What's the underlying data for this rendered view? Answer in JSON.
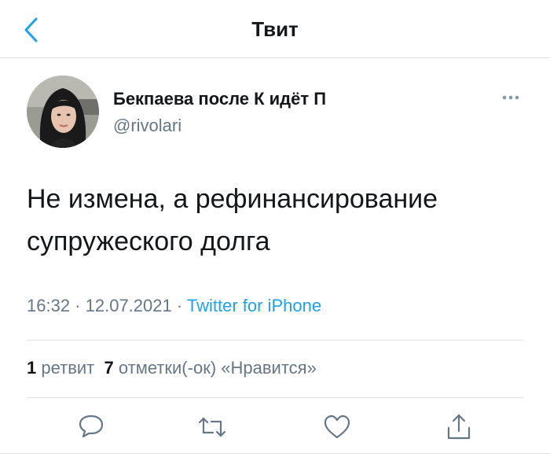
{
  "header": {
    "title": "Твит"
  },
  "author": {
    "name": "Бекпаева после К идёт П",
    "handle": "@rivolari"
  },
  "tweet": {
    "lines": [
      "Не измена, а рефинансирование",
      "супружеского долга"
    ],
    "time": "16:32",
    "sep1": " · ",
    "date": "12.07.2021",
    "sep2": " · ",
    "source": "Twitter for iPhone"
  },
  "stats": {
    "retweets_count": "1",
    "retweets_label": "ретвит",
    "likes_count": "7",
    "likes_label": "отметки(-ок) «Нравится»"
  },
  "icons": {
    "back": "chevron-left-icon",
    "more": "more-dots-icon",
    "reply": "reply-icon",
    "retweet": "retweet-icon",
    "like": "heart-icon",
    "share": "share-icon"
  },
  "colors": {
    "accent": "#1da1f2",
    "secondary": "#657786",
    "text": "#14171a"
  }
}
